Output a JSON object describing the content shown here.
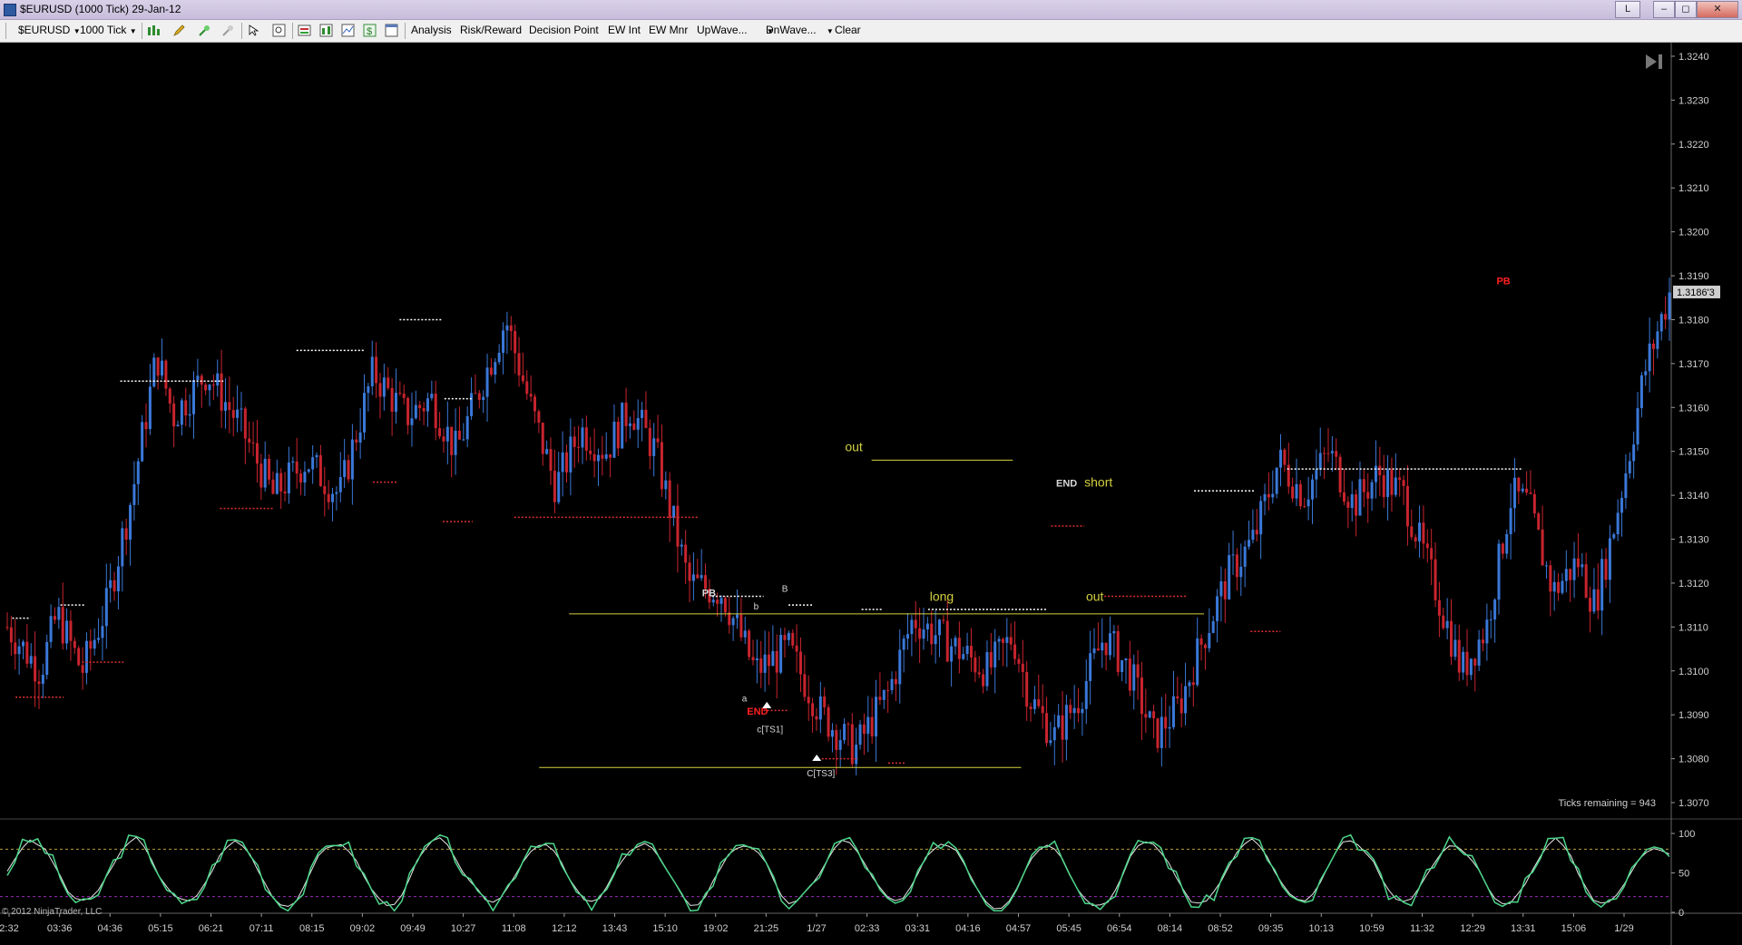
{
  "window": {
    "title": "$EURUSD (1000 Tick)  29-Jan-12",
    "link_button": "L",
    "minimize": "–",
    "restore": "◻",
    "close": "✕"
  },
  "toolbar": {
    "instrument": "$EURUSD",
    "interval": "1000 Tick",
    "analysis": "Analysis",
    "risk_reward": "Risk/Reward",
    "decision_point": "Decision Point",
    "ew_int": "EW Int",
    "ew_mnr": "EW Mnr",
    "upwave": "UpWave...",
    "dnwave": "DnWave...",
    "clear": "Clear",
    "icons": [
      "bar-chart-icon",
      "pencil-icon",
      "zoom-in-icon",
      "zoom-out-icon",
      "pointer-icon",
      "search-icon",
      "properties-icon",
      "strategy-icon",
      "chart-trader-icon",
      "dollar-icon",
      "data-box-icon"
    ]
  },
  "price_axis": {
    "labels": [
      "1.3240",
      "1.3230",
      "1.3220",
      "1.3210",
      "1.3200",
      "1.3190",
      "1.3180",
      "1.3170",
      "1.3160",
      "1.3150",
      "1.3140",
      "1.3130",
      "1.3120",
      "1.3110",
      "1.3100",
      "1.3090",
      "1.3080",
      "1.3070"
    ],
    "current_price": "1.3186'3"
  },
  "time_axis": {
    "labels": [
      "2:32",
      "03:36",
      "04:36",
      "05:15",
      "06:21",
      "07:11",
      "08:15",
      "09:02",
      "09:49",
      "10:27",
      "11:08",
      "12:12",
      "13:43",
      "15:10",
      "19:02",
      "21:25",
      "1/27",
      "02:33",
      "03:31",
      "04:16",
      "04:57",
      "05:45",
      "06:54",
      "08:14",
      "08:52",
      "09:35",
      "10:13",
      "10:59",
      "11:32",
      "12:29",
      "13:31",
      "15:06",
      "1/29"
    ]
  },
  "oscillator_axis": {
    "labels": [
      "100",
      "50",
      "0"
    ]
  },
  "annotations": {
    "pb_top": "PB",
    "b_small": "b",
    "b_cap": "B",
    "a_small": "a",
    "end_red": "END",
    "ts1": "c[TS1]",
    "ts3": "C[TS3]",
    "out_left": "out",
    "long": "long",
    "out_right": "out",
    "end_white": "END",
    "short": "short",
    "pb_right": "PB"
  },
  "colors": {
    "up_bar": "#3a78d8",
    "down_bar": "#c8242e",
    "zone_line": "#d4d040",
    "stoch_k": "#4cd68a",
    "stoch_d": "#e8e8e8",
    "level_upper": "#b89a3a",
    "level_lower": "#9a2ab8"
  },
  "status": {
    "ticks_remaining": "Ticks remaining = 943",
    "copyright": "© 2012 NinjaTrader, LLC"
  },
  "chart_data": {
    "type": "candlestick",
    "instrument": "$EURUSD",
    "interval": "1000 Tick",
    "ylim": [
      1.3065,
      1.3245
    ],
    "close_profile": [
      [
        0,
        1.311
      ],
      [
        0.02,
        1.31
      ],
      [
        0.03,
        1.3113
      ],
      [
        0.045,
        1.31
      ],
      [
        0.06,
        1.3115
      ],
      [
        0.075,
        1.314
      ],
      [
        0.09,
        1.3172
      ],
      [
        0.1,
        1.3158
      ],
      [
        0.12,
        1.3168
      ],
      [
        0.14,
        1.3156
      ],
      [
        0.16,
        1.314
      ],
      [
        0.18,
        1.3148
      ],
      [
        0.2,
        1.314
      ],
      [
        0.22,
        1.3168
      ],
      [
        0.24,
        1.3158
      ],
      [
        0.255,
        1.3162
      ],
      [
        0.27,
        1.315
      ],
      [
        0.285,
        1.3165
      ],
      [
        0.3,
        1.318
      ],
      [
        0.315,
        1.316
      ],
      [
        0.33,
        1.3142
      ],
      [
        0.345,
        1.3155
      ],
      [
        0.36,
        1.315
      ],
      [
        0.375,
        1.316
      ],
      [
        0.39,
        1.315
      ],
      [
        0.41,
        1.312
      ],
      [
        0.43,
        1.3118
      ],
      [
        0.45,
        1.31
      ],
      [
        0.47,
        1.3105
      ],
      [
        0.49,
        1.309
      ],
      [
        0.51,
        1.3082
      ],
      [
        0.53,
        1.3095
      ],
      [
        0.545,
        1.3112
      ],
      [
        0.56,
        1.3108
      ],
      [
        0.575,
        1.3104
      ],
      [
        0.59,
        1.31
      ],
      [
        0.605,
        1.3108
      ],
      [
        0.615,
        1.3094
      ],
      [
        0.63,
        1.3085
      ],
      [
        0.645,
        1.3094
      ],
      [
        0.66,
        1.3108
      ],
      [
        0.675,
        1.31
      ],
      [
        0.69,
        1.3085
      ],
      [
        0.705,
        1.3092
      ],
      [
        0.72,
        1.3108
      ],
      [
        0.735,
        1.3122
      ],
      [
        0.75,
        1.313
      ],
      [
        0.765,
        1.3148
      ],
      [
        0.78,
        1.314
      ],
      [
        0.795,
        1.315
      ],
      [
        0.81,
        1.3138
      ],
      [
        0.825,
        1.3145
      ],
      [
        0.84,
        1.314
      ],
      [
        0.86,
        1.3118
      ],
      [
        0.875,
        1.31
      ],
      [
        0.89,
        1.311
      ],
      [
        0.905,
        1.314
      ],
      [
        0.915,
        1.3138
      ],
      [
        0.93,
        1.3118
      ],
      [
        0.945,
        1.3125
      ],
      [
        0.955,
        1.3115
      ],
      [
        0.965,
        1.313
      ],
      [
        0.975,
        1.3148
      ],
      [
        0.985,
        1.3168
      ],
      [
        1.0,
        1.3186
      ]
    ],
    "support_line": 1.3078,
    "zone_line": 1.3113,
    "out_line": 1.3148,
    "oscillator": {
      "type": "stochastics",
      "levels": [
        80,
        20
      ],
      "ylim": [
        0,
        100
      ]
    }
  }
}
